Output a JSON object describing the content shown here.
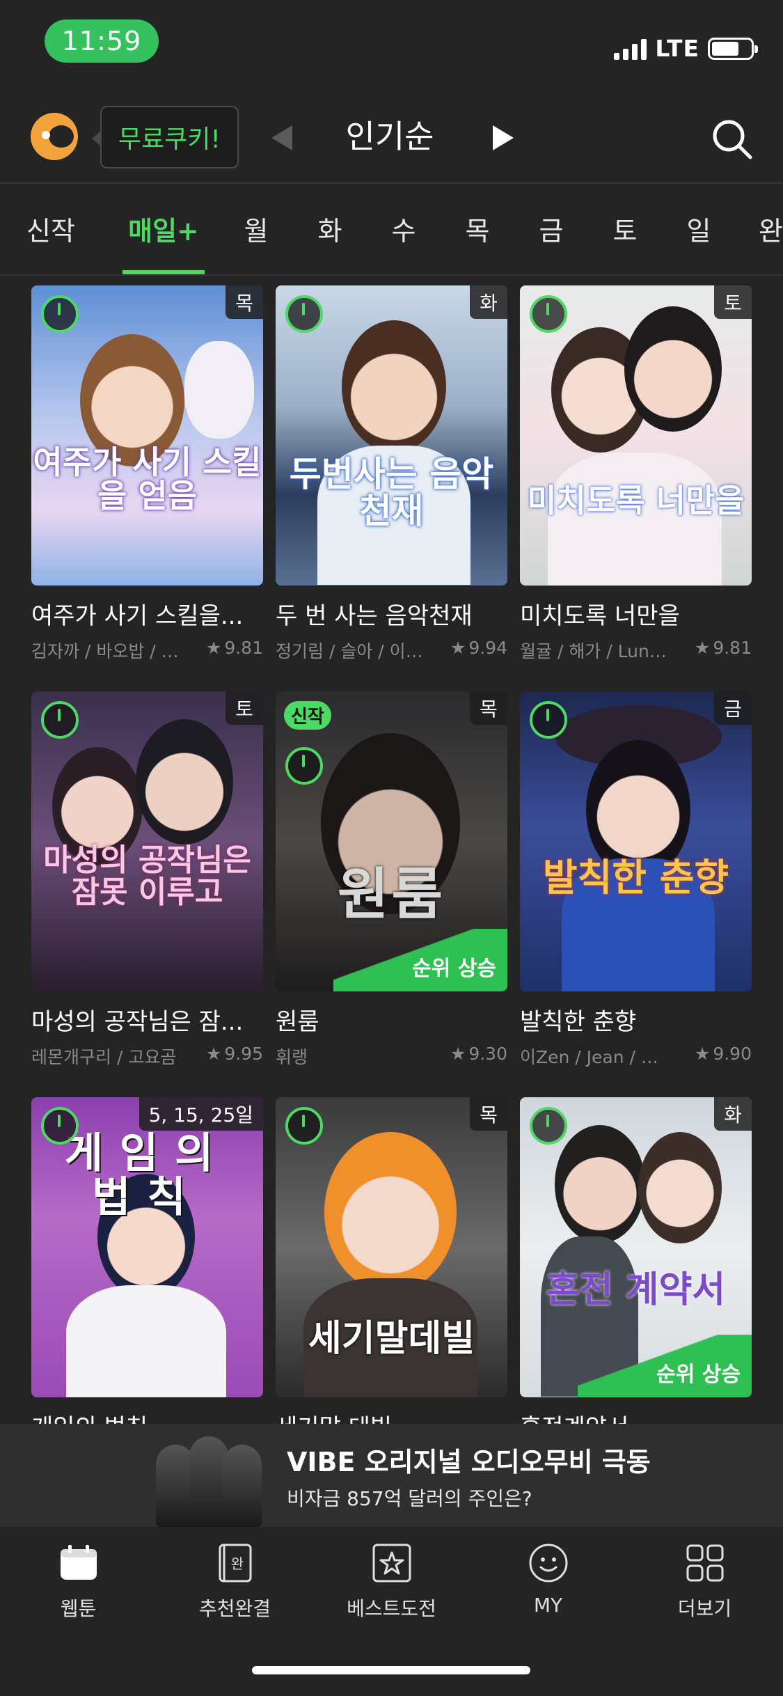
{
  "status_bar": {
    "time": "11:59",
    "network": "LTE"
  },
  "header": {
    "free_cookie_label": "무료쿠키!",
    "sort_label": "인기순"
  },
  "tabs": [
    "신작",
    "매일+",
    "월",
    "화",
    "수",
    "목",
    "금",
    "토",
    "일",
    "완결"
  ],
  "active_tab": "매일+",
  "comics": [
    {
      "title": "여주가 사기 스킬을...",
      "authors": "김자까 / 바오밥 / 슈...",
      "rating": "9.81",
      "day": "목",
      "cover_text": "여주가 사기 스킬을 얻음"
    },
    {
      "title": "두 번 사는 음악천재",
      "authors": "정기림 / 슬아 / 이한이",
      "rating": "9.94",
      "day": "화",
      "cover_text": "두번사는 음악천재"
    },
    {
      "title": "미치도록 너만을",
      "authors": "월귤 / 해가 / Lunar...",
      "rating": "9.81",
      "day": "토",
      "cover_text": "미치도록 너만을"
    },
    {
      "title": "마성의 공작님은 잠...",
      "authors": "레몬개구리 / 고요곰",
      "rating": "9.95",
      "day": "토",
      "cover_text": "마성의 공작님은 잠못 이루고"
    },
    {
      "title": "원룸",
      "authors": "휘랭",
      "rating": "9.30",
      "day": "목",
      "cover_text": "원룸",
      "new_label": "신작",
      "rank_up": "순위 상승"
    },
    {
      "title": "발칙한 춘향",
      "authors": "이Zen / Jean / 금...",
      "rating": "9.90",
      "day": "금",
      "cover_text": "발칙한 춘향"
    },
    {
      "title": "게임의 법칙",
      "day": "5, 15, 25일",
      "cover_text": "게임의 법칙"
    },
    {
      "title": "세기말 데빌",
      "day": "목",
      "cover_text": "세기말데빌"
    },
    {
      "title": "혼전계약서",
      "day": "화",
      "cover_text": "혼전 계약서",
      "rank_up": "순위 상승"
    }
  ],
  "ad": {
    "headline": "VIBE 오리지널 오디오무비 극동",
    "subline": "비자금 857억 달러의 주인은?"
  },
  "bottom_nav": [
    {
      "label": "웹툰",
      "icon": "calendar-icon"
    },
    {
      "label": "추천완결",
      "icon": "book-complete-icon"
    },
    {
      "label": "베스트도전",
      "icon": "star-box-icon"
    },
    {
      "label": "MY",
      "icon": "smiley-icon"
    },
    {
      "label": "더보기",
      "icon": "grid-icon"
    }
  ],
  "colors": {
    "accent": "#4cd964",
    "background": "#242424",
    "cookie": "#f2a33a"
  }
}
